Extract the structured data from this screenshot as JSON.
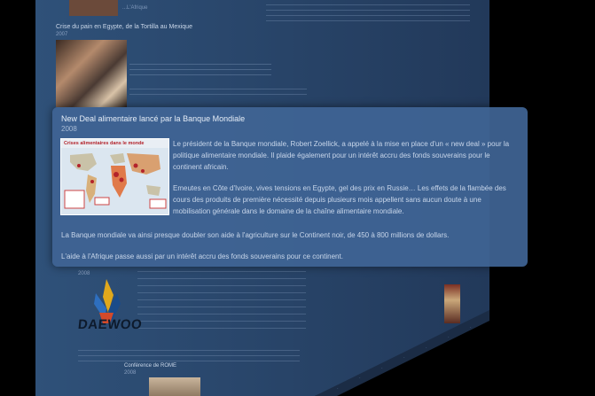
{
  "background": {
    "top_text": "...L'Afrique",
    "entry1": {
      "title": "Crise du pain en Egypte, de la Tortilla au Mexique",
      "year": "2007"
    },
    "entry2": {
      "year": "2008"
    },
    "entry3": {
      "title": "Conférence de ROME",
      "year": "2008"
    },
    "logo_text": "DAEWOO"
  },
  "card": {
    "title": "New Deal alimentaire lancé par la Banque Mondiale",
    "date": "2008",
    "map_title": "Crises alimentaires dans le monde",
    "paragraph1": "Le président de la Banque mondiale, Robert Zoellick, a appelé à la mise en place d'un « new deal » pour la politique alimentaire mondiale. Il plaide également pour un intérêt accru des fonds souverains pour le continent africain.",
    "paragraph2": "Emeutes en Côte d'Ivoire, vives tensions en Egypte, gel des prix en Russie… Les effets de la flambée des cours des produits de première nécessité depuis plusieurs mois appellent sans aucun doute à une mobilisation générale dans le domaine de la chaîne alimentaire mondiale.",
    "paragraph3": "La Banque mondiale va ainsi presque doubler son aide à l'agriculture sur le Continent noir, de 450 à 800 millions de dollars.",
    "paragraph4": "L'aide à l'Afrique passe aussi par un intérêt accru des fonds souverains pour ce continent."
  },
  "colors": {
    "panel": "#2b4a73",
    "card": "#40648f",
    "text": "#c8d6ea"
  }
}
